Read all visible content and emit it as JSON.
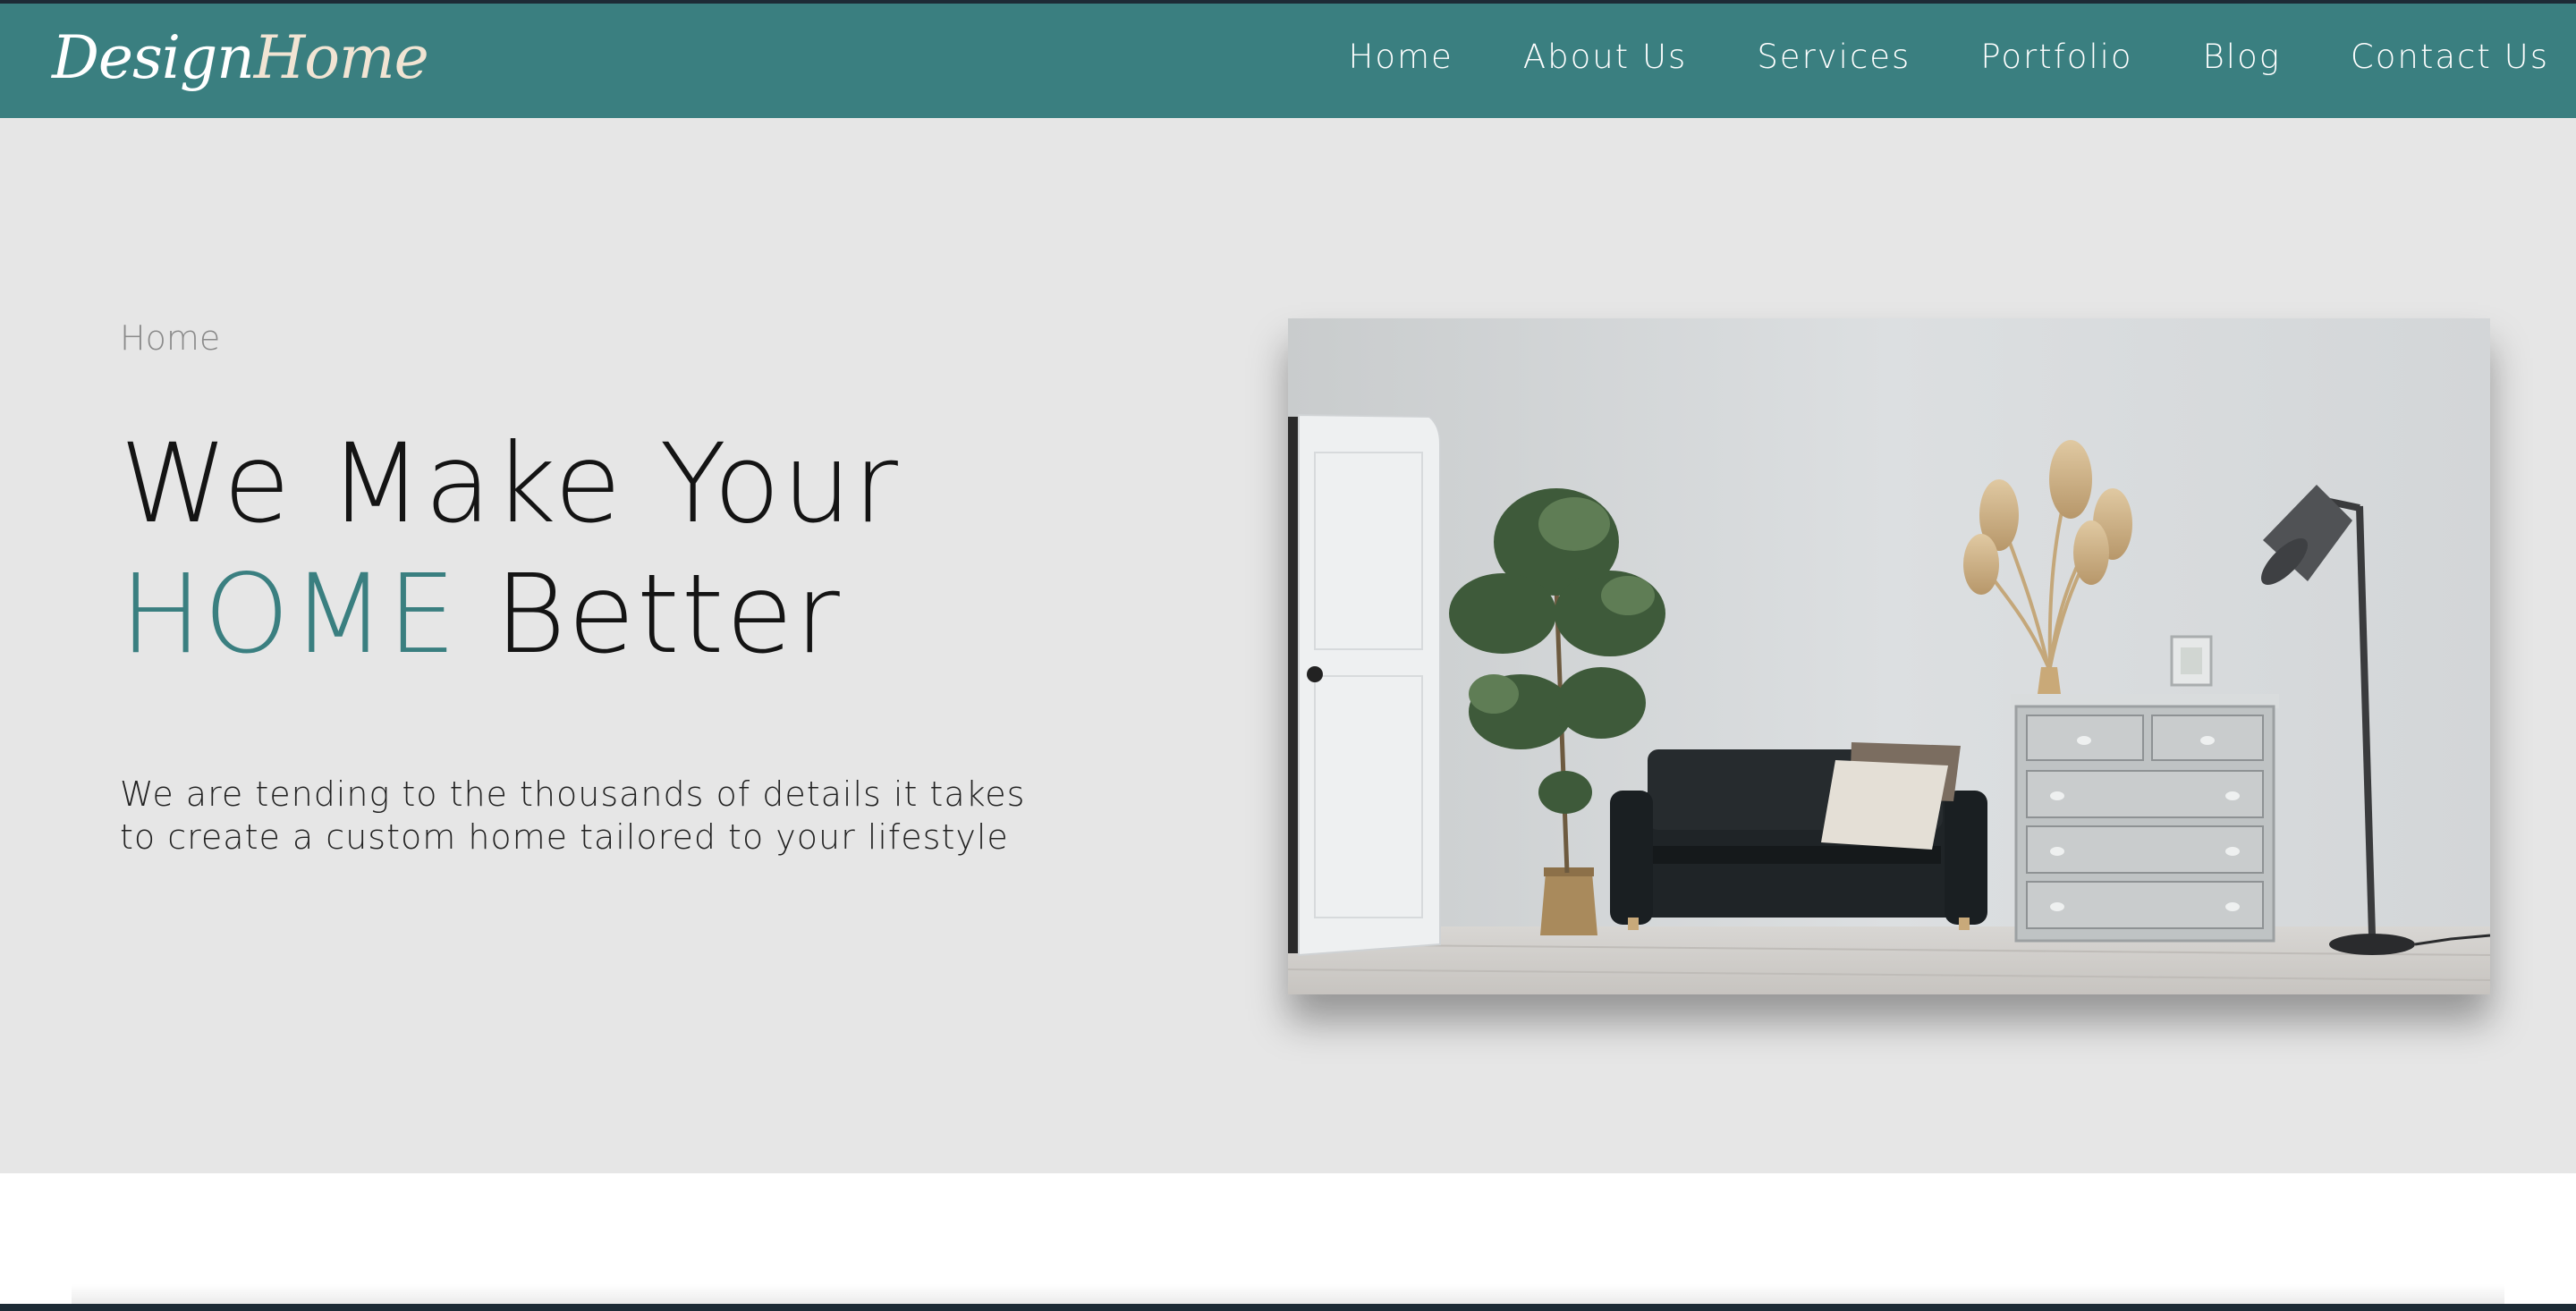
{
  "brand": {
    "part1": "Design",
    "part2": "Home"
  },
  "nav": {
    "items": [
      "Home",
      "About Us",
      "Services",
      "Portfolio",
      "Blog",
      "Contact Us"
    ]
  },
  "hero": {
    "breadcrumb": "Home",
    "headline_line1": "We Make Your",
    "headline_accent": "HOME",
    "headline_rest": " Better",
    "description": "We are tending to the thousands of details it takes to create a custom home tailored to your lifestyle",
    "image_alt": "living-room-photo"
  },
  "colors": {
    "brand_teal": "#3a7f80",
    "hero_bg": "#e6e6e6",
    "logo_accent": "#f1e4d3"
  }
}
